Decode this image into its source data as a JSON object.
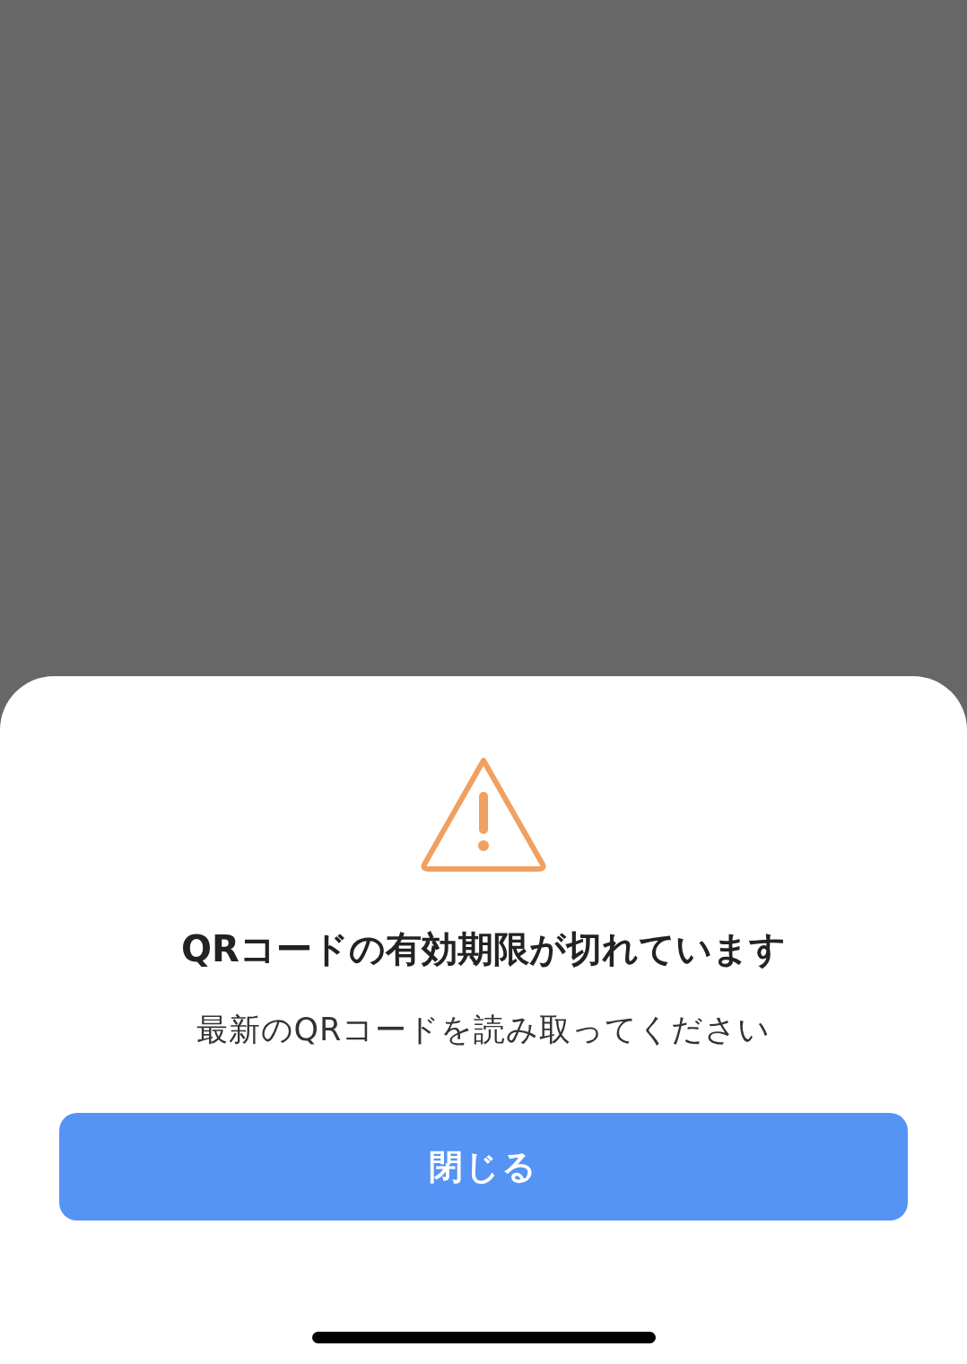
{
  "dialog": {
    "title": "QRコードの有効期限が切れています",
    "message": "最新のQRコードを読み取ってください",
    "button": {
      "label": "閉じる"
    }
  }
}
